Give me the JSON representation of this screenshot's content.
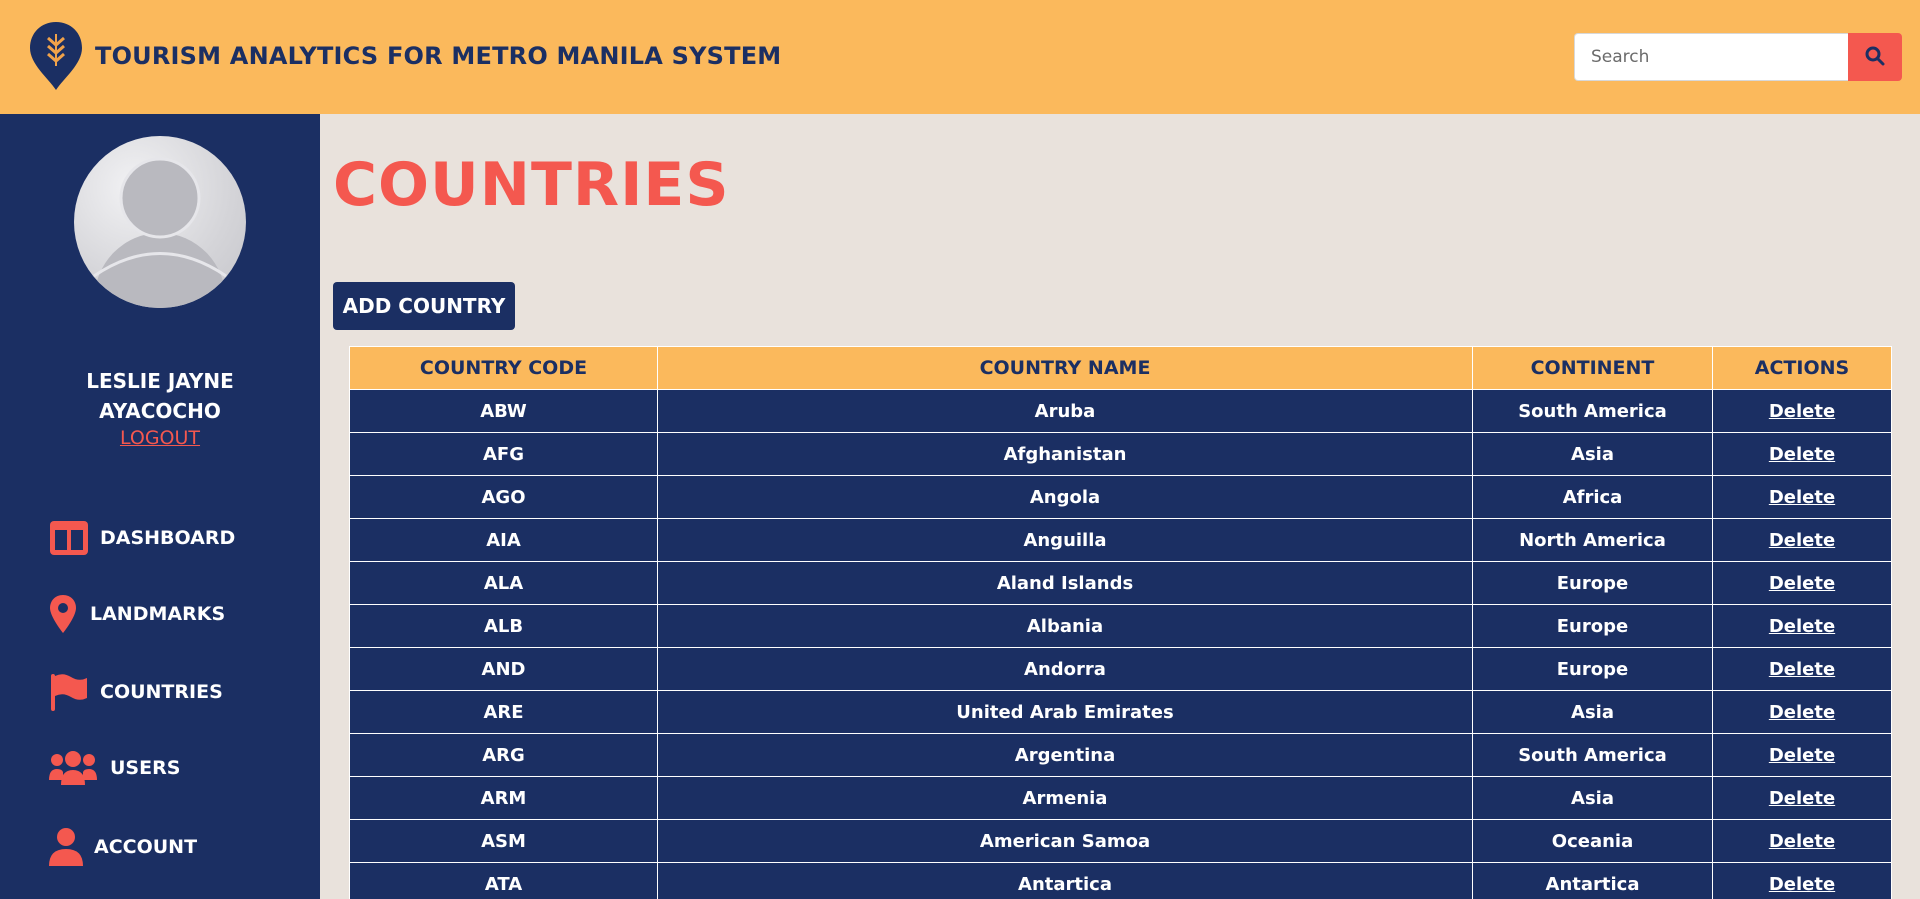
{
  "header": {
    "app_title": "TOURISM ANALYTICS FOR METRO MANILA SYSTEM",
    "search_placeholder": "Search"
  },
  "colors": {
    "header_bg": "#fbb95c",
    "sidebar_bg": "#1b2f63",
    "accent": "#f4584f",
    "page_bg": "#e9e2dc"
  },
  "sidebar": {
    "user_first": "LESLIE JAYNE",
    "user_last": "AYACOCHO",
    "logout_label": "LOGOUT",
    "items": [
      {
        "label": "DASHBOARD",
        "icon": "dashboard-icon"
      },
      {
        "label": "LANDMARKS",
        "icon": "map-pin-icon"
      },
      {
        "label": "COUNTRIES",
        "icon": "flag-icon"
      },
      {
        "label": "USERS",
        "icon": "users-icon"
      },
      {
        "label": "ACCOUNT",
        "icon": "user-icon"
      }
    ]
  },
  "main": {
    "title": "COUNTRIES",
    "add_button": "ADD COUNTRY",
    "table": {
      "headers": [
        "COUNTRY CODE",
        "COUNTRY NAME",
        "CONTINENT",
        "ACTIONS"
      ],
      "rows": [
        {
          "code": "ABW",
          "name": "Aruba",
          "continent": "South America",
          "action": "Delete"
        },
        {
          "code": "AFG",
          "name": "Afghanistan",
          "continent": "Asia",
          "action": "Delete"
        },
        {
          "code": "AGO",
          "name": "Angola",
          "continent": "Africa",
          "action": "Delete"
        },
        {
          "code": "AIA",
          "name": "Anguilla",
          "continent": "North America",
          "action": "Delete"
        },
        {
          "code": "ALA",
          "name": "Aland Islands",
          "continent": "Europe",
          "action": "Delete"
        },
        {
          "code": "ALB",
          "name": "Albania",
          "continent": "Europe",
          "action": "Delete"
        },
        {
          "code": "AND",
          "name": "Andorra",
          "continent": "Europe",
          "action": "Delete"
        },
        {
          "code": "ARE",
          "name": "United Arab Emirates",
          "continent": "Asia",
          "action": "Delete"
        },
        {
          "code": "ARG",
          "name": "Argentina",
          "continent": "South America",
          "action": "Delete"
        },
        {
          "code": "ARM",
          "name": "Armenia",
          "continent": "Asia",
          "action": "Delete"
        },
        {
          "code": "ASM",
          "name": "American Samoa",
          "continent": "Oceania",
          "action": "Delete"
        },
        {
          "code": "ATA",
          "name": "Antartica",
          "continent": "Antartica",
          "action": "Delete"
        }
      ]
    }
  }
}
